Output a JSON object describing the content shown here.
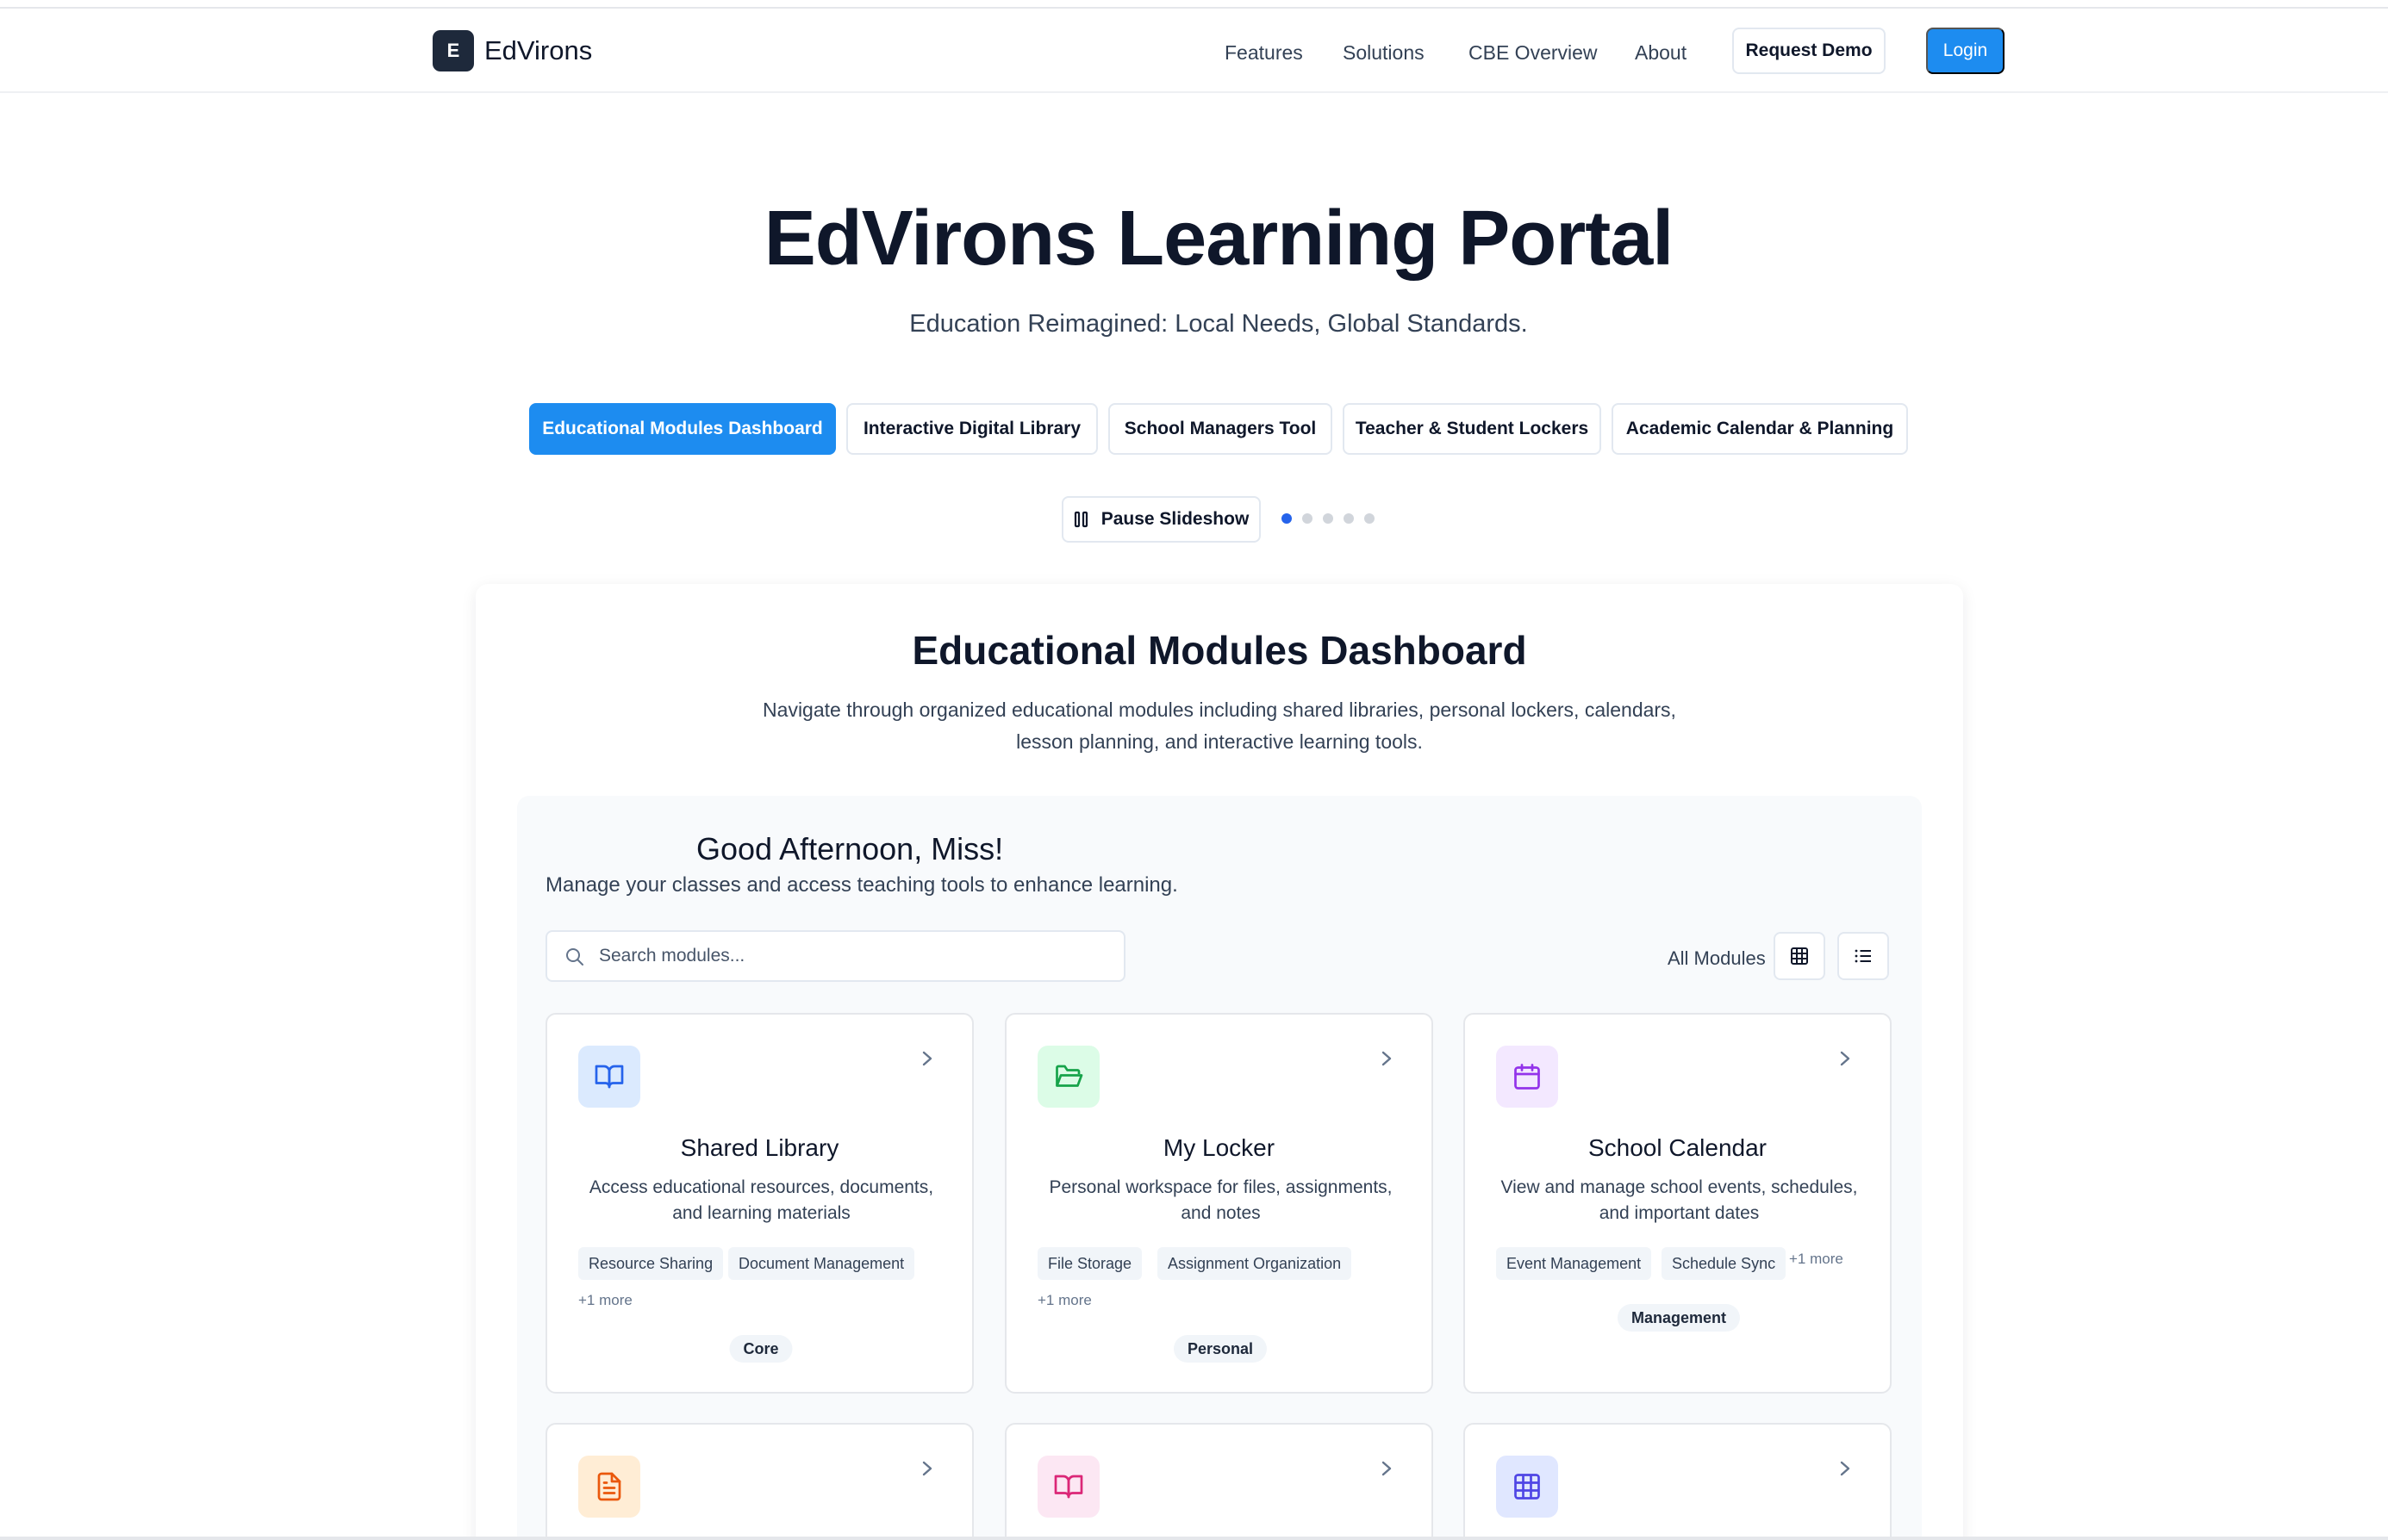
{
  "nav": {
    "brand_initial": "E",
    "brand": "EdVirons",
    "links": [
      "Features",
      "Solutions",
      "CBE Overview",
      "About"
    ],
    "demo_label": "Request Demo",
    "login_label": "Login"
  },
  "hero": {
    "title": "EdVirons Learning Portal",
    "subtitle": "Education Reimagined: Local Needs, Global Standards.",
    "tabs": [
      "Educational Modules Dashboard",
      "Interactive Digital Library",
      "School Managers Tool",
      "Teacher & Student Lockers",
      "Academic Calendar & Planning"
    ],
    "active_tab": 0,
    "pause_label": "Pause Slideshow",
    "slide_count": 5,
    "active_slide": 0
  },
  "dashboard": {
    "title": "Educational Modules Dashboard",
    "description": "Navigate through organized educational modules including shared libraries, personal lockers, calendars, lesson planning, and interactive learning tools.",
    "greeting": "Good Afternoon, Miss!",
    "greeting_sub": "Manage your classes and access teaching tools to enhance learning.",
    "search_placeholder": "Search modules...",
    "filter_label": "All Modules",
    "modules": [
      {
        "title": "Shared Library",
        "description": "Access educational resources, documents, and learning materials",
        "tags": [
          "Resource Sharing",
          "Document Management"
        ],
        "more": "+1 more",
        "badge": "Core",
        "icon": "book-open-icon"
      },
      {
        "title": "My Locker",
        "description": "Personal workspace for files, assignments, and notes",
        "tags": [
          "File Storage",
          "Assignment Organization"
        ],
        "more": "+1 more",
        "badge": "Personal",
        "icon": "folder-open-icon"
      },
      {
        "title": "School Calendar",
        "description": "View and manage school events, schedules, and important dates",
        "tags": [
          "Event Management",
          "Schedule Sync"
        ],
        "more": "+1 more",
        "badge": "Management",
        "icon": "calendar-icon"
      }
    ],
    "more_modules_icons": [
      "file-text-icon",
      "book-open-icon",
      "grid-table-icon"
    ]
  },
  "colors": {
    "primary": "#1d8cf0",
    "dot_active": "#2563eb",
    "blue_tile": "#dbeafe",
    "blue_icon": "#2563eb",
    "green_tile": "#dcfce7",
    "green_icon": "#16a34a",
    "purple_tile": "#f3e8ff",
    "purple_icon": "#9333ea",
    "orange_tile": "#ffedd5",
    "orange_icon": "#ea580c",
    "pink_tile": "#fce7f3",
    "pink_icon": "#db2777",
    "indigo_tile": "#e0e7ff",
    "indigo_icon": "#4f46e5"
  }
}
